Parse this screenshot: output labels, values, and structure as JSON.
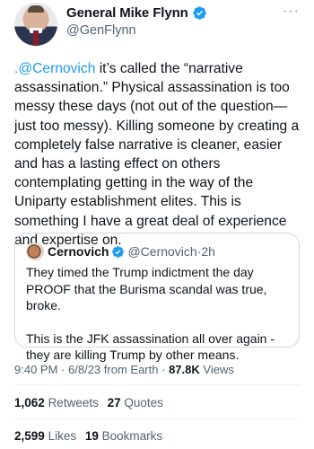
{
  "author": {
    "name": "General Mike Flynn",
    "handle": "@GenFlynn"
  },
  "tweet": {
    "mention": ".@Cernovich",
    "text": " it’s called the “narrative assassination.” Physical assassination is too messy these days (not out of the question—just too messy). Killing someone by creating a completely false narrative is cleaner, easier and has a lasting effect on others contemplating getting in the way of the Uniparty establishment elites. This is something I have a great deal of experience and expertise on."
  },
  "quote": {
    "name": "Cernovich",
    "handle": "@Cernovich",
    "separator": "·",
    "time": "2h",
    "paragraph1": "They timed the Trump indictment the day PROOF that the Burisma scandal was true, broke.",
    "paragraph2": "This is the JFK assassination all over again - they are killing Trump by other means."
  },
  "meta": {
    "time": "9:40 PM",
    "sep1": "·",
    "date": "6/8/23",
    "source": "from Earth",
    "sep2": "·",
    "views_count": "87.8K",
    "views_label": "Views"
  },
  "stats": {
    "retweets_count": "1,062",
    "retweets_label": "Retweets",
    "quotes_count": "27",
    "quotes_label": "Quotes",
    "likes_count": "2,599",
    "likes_label": "Likes",
    "bookmarks_count": "19",
    "bookmarks_label": "Bookmarks"
  },
  "colors": {
    "accent": "#1d9bf0",
    "secondary_text": "#536471",
    "primary_text": "#0f1419"
  },
  "icons": {
    "verified": "verified-badge-icon",
    "more": "more-horizontal-icon"
  }
}
